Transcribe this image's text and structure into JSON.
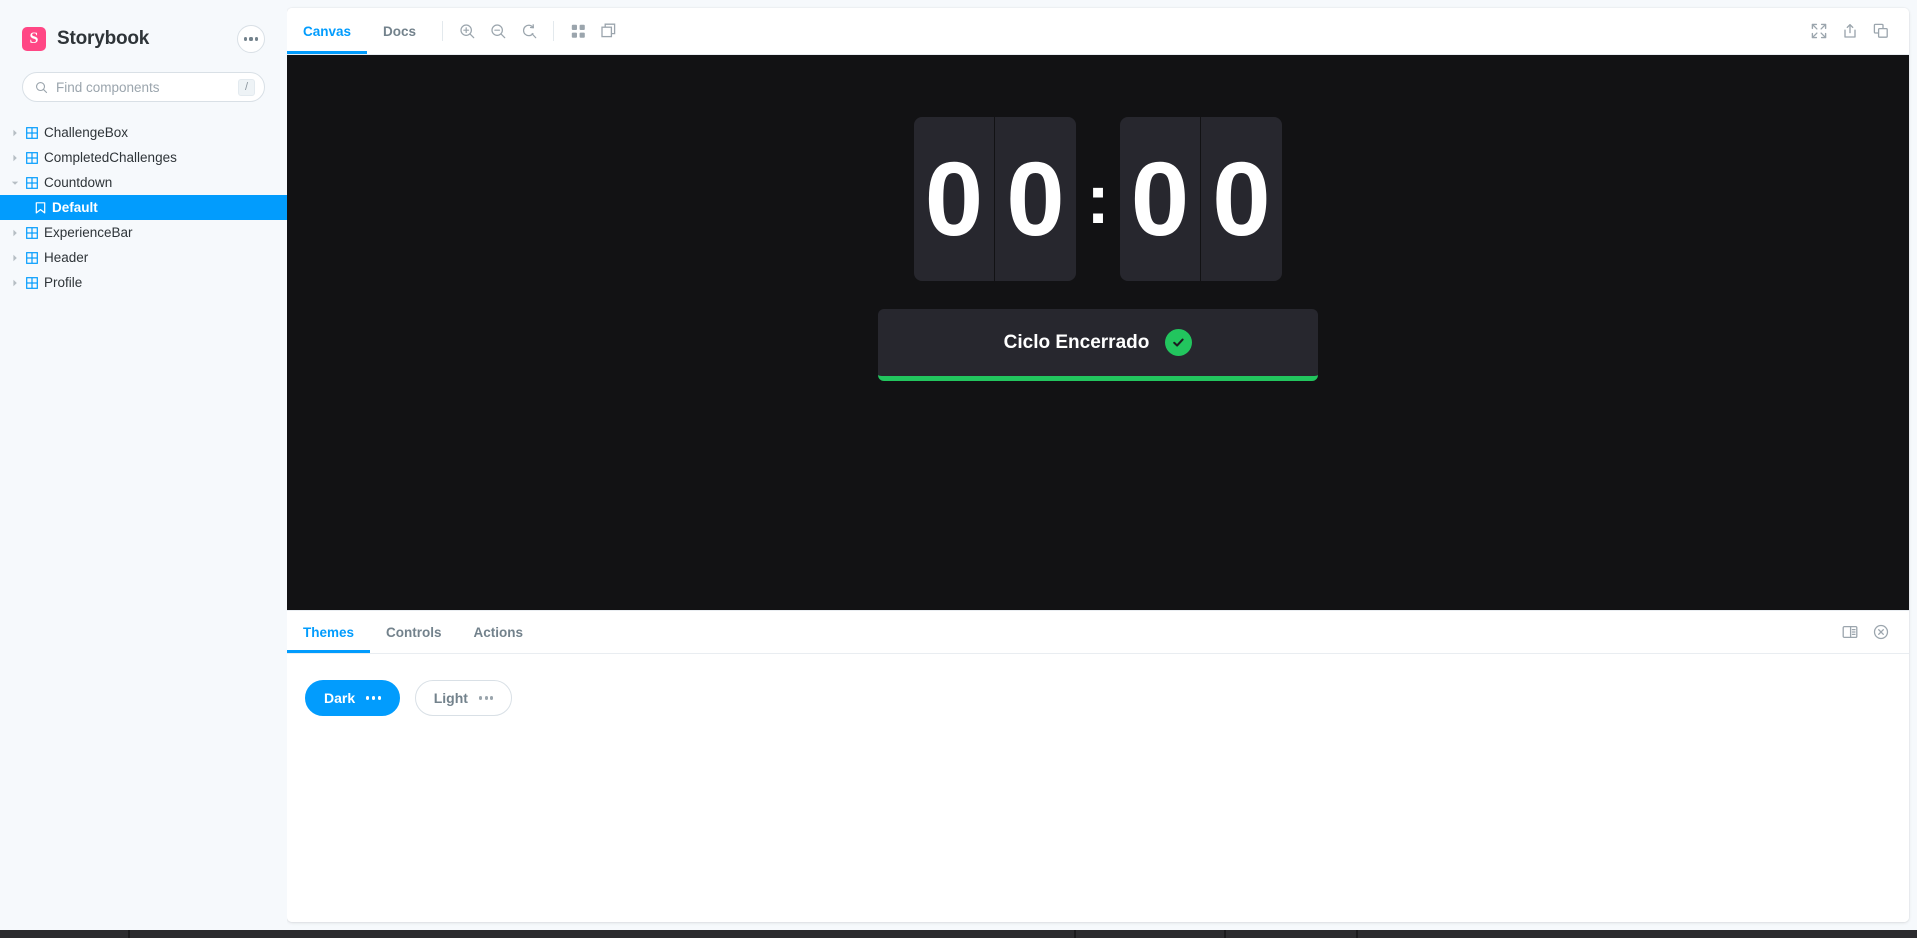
{
  "sidebar": {
    "brand": {
      "name": "Storybook",
      "logo_letter": "S",
      "logo_color": "#FF4785"
    },
    "menu_button": "menu-dots",
    "search": {
      "placeholder": "Find components",
      "value": "",
      "shortcut_key": "/"
    },
    "tree": [
      {
        "label": "ChallengeBox",
        "type": "component",
        "expanded": false,
        "selected": false
      },
      {
        "label": "CompletedChallenges",
        "type": "component",
        "expanded": false,
        "selected": false
      },
      {
        "label": "Countdown",
        "type": "component",
        "expanded": true,
        "selected": false
      },
      {
        "label": "Default",
        "type": "story",
        "expanded": false,
        "selected": true
      },
      {
        "label": "ExperienceBar",
        "type": "component",
        "expanded": false,
        "selected": false
      },
      {
        "label": "Header",
        "type": "component",
        "expanded": false,
        "selected": false
      },
      {
        "label": "Profile",
        "type": "component",
        "expanded": false,
        "selected": false
      }
    ]
  },
  "toolbar": {
    "tabs": [
      {
        "label": "Canvas",
        "active": true
      },
      {
        "label": "Docs",
        "active": false
      }
    ],
    "left_icons": [
      {
        "name": "zoom-in-icon"
      },
      {
        "name": "zoom-out-icon"
      },
      {
        "name": "zoom-reset-icon"
      },
      {
        "name": "grid-background-icon"
      },
      {
        "name": "measure-outline-icon"
      }
    ],
    "right_icons": [
      {
        "name": "fullscreen-icon"
      },
      {
        "name": "open-in-new-tab-icon"
      },
      {
        "name": "copy-canvas-link-icon"
      }
    ]
  },
  "preview": {
    "background": "#121214",
    "countdown": {
      "minutes_tens": "0",
      "minutes_ones": "0",
      "separator": ":",
      "seconds_tens": "0",
      "seconds_ones": "0",
      "display": "00:00"
    },
    "cycle_button": {
      "label": "Ciclo Encerrado",
      "icon": "check-circle-icon",
      "accent_color": "#22C55E",
      "background": "#27272E"
    }
  },
  "addons": {
    "tabs": [
      {
        "label": "Themes",
        "active": true
      },
      {
        "label": "Controls",
        "active": false
      },
      {
        "label": "Actions",
        "active": false
      }
    ],
    "panel_icons": [
      {
        "name": "panel-position-icon"
      },
      {
        "name": "close-panel-icon"
      }
    ],
    "themes": [
      {
        "label": "Dark",
        "active": true,
        "menu": "theme-dots"
      },
      {
        "label": "Light",
        "active": false,
        "menu": "theme-dots"
      }
    ]
  },
  "colors": {
    "accent_blue": "#029CFD",
    "brand_pink": "#FF4785",
    "success_green": "#22C55E",
    "canvas_dark": "#121214",
    "panel_dark": "#27272E"
  }
}
